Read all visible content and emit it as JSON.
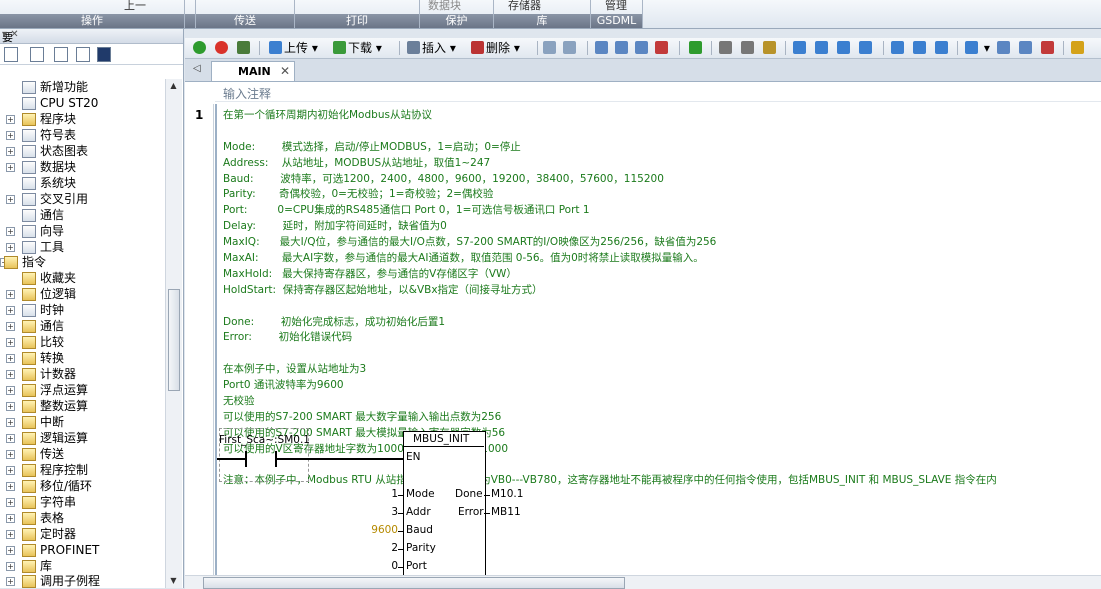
{
  "ribbon": {
    "top_fragments": [
      "上一",
      "数据块",
      "存储器",
      "管理"
    ],
    "groups": [
      "操作",
      "",
      "传送",
      "打印",
      "保护",
      "库",
      "GSDML"
    ]
  },
  "left_panel": {
    "title": "要",
    "tree": [
      {
        "label": "新增功能",
        "icon": "help-icon"
      },
      {
        "label": "CPU ST20",
        "icon": "cpu-icon"
      },
      {
        "label": "程序块",
        "icon": "folder-icon"
      },
      {
        "label": "符号表",
        "icon": "table-icon"
      },
      {
        "label": "状态图表",
        "icon": "table-icon"
      },
      {
        "label": "数据块",
        "icon": "table-icon"
      },
      {
        "label": "系统块",
        "icon": "system-icon"
      },
      {
        "label": "交叉引用",
        "icon": "table-icon"
      },
      {
        "label": "通信",
        "icon": "network-icon"
      },
      {
        "label": "向导",
        "icon": "wizard-icon"
      },
      {
        "label": "工具",
        "icon": "tools-icon"
      },
      {
        "label": "指令",
        "icon": "folder-icon"
      },
      {
        "label": "收藏夹",
        "icon": "folder-icon"
      },
      {
        "label": "位逻辑",
        "icon": "folder-icon"
      },
      {
        "label": "时钟",
        "icon": "clock-icon"
      },
      {
        "label": "通信",
        "icon": "folder-icon"
      },
      {
        "label": "比较",
        "icon": "folder-icon"
      },
      {
        "label": "转换",
        "icon": "folder-icon"
      },
      {
        "label": "计数器",
        "icon": "folder-icon"
      },
      {
        "label": "浮点运算",
        "icon": "folder-icon"
      },
      {
        "label": "整数运算",
        "icon": "folder-icon"
      },
      {
        "label": "中断",
        "icon": "folder-icon"
      },
      {
        "label": "逻辑运算",
        "icon": "folder-icon"
      },
      {
        "label": "传送",
        "icon": "folder-icon"
      },
      {
        "label": "程序控制",
        "icon": "folder-icon"
      },
      {
        "label": "移位/循环",
        "icon": "folder-icon"
      },
      {
        "label": "字符串",
        "icon": "folder-icon"
      },
      {
        "label": "表格",
        "icon": "folder-icon"
      },
      {
        "label": "定时器",
        "icon": "folder-icon"
      },
      {
        "label": "PROFINET",
        "icon": "folder-icon"
      },
      {
        "label": "库",
        "icon": "folder-icon"
      },
      {
        "label": "调用子例程",
        "icon": "folder-icon"
      }
    ]
  },
  "toolbar": {
    "upload": "上传",
    "download": "下载",
    "insert": "插入",
    "delete": "删除"
  },
  "tabs": {
    "main": "MAIN"
  },
  "editor": {
    "comment_placeholder": "输入注释",
    "network_number": "1",
    "comment_lines": [
      "在第一个循环周期内初始化Modbus从站协议",
      "",
      "Mode:        模式选择，启动/停止MODBUS，1=启动；0=停止",
      "Address:    从站地址，MODBUS从站地址，取值1~247",
      "Baud:        波特率，可选1200，2400，4800，9600，19200，38400，57600，115200",
      "Parity:       奇偶校验，0=无校验；1=奇校验；2=偶校验",
      "Port:         0=CPU集成的RS485通信口 Port 0，1=可选信号板通讯口 Port 1",
      "Delay:        延时，附加字符间延时，缺省值为0",
      "MaxIQ:      最大I/Q位，参与通信的最大I/O点数，S7-200 SMART的I/O映像区为256/256，缺省值为256",
      "MaxAI:       最大AI字数，参与通信的最大AI通道数，取值范围 0-56。值为0时将禁止读取模拟量输入。",
      "MaxHold:   最大保持寄存器区，参与通信的V存储区字（VW）",
      "HoldStart:  保持寄存器区起始地址，以&VBx指定（间接寻址方式）",
      "",
      "Done:        初始化完成标志，成功初始化后置1",
      "Error:        初始化错误代码",
      "",
      "在本例子中，设置从站地址为3",
      "Port0 通讯波特率为9600",
      "无校验",
      "可以使用的S7-200 SMART 最大数字量输入输出点数为256",
      "可以使用的S7-200 SMART 最大模拟量输入寄存器字数为56",
      "可以使用的V区寄存器地址字数为1000，起始地址为VB1000",
      "",
      "注意：本例子中，Modbus RTU 从站指令使用的库存储为VB0---VB780，这寄存器地址不能再被程序中的任何指令使用，包括MBUS_INIT 和 MBUS_SLAVE 指令在内"
    ],
    "contact_symbol": "First_Sca~:SM0.1",
    "block_name": "MBUS_INIT",
    "en": "EN",
    "inputs": [
      {
        "pin": "Mode",
        "value": "1"
      },
      {
        "pin": "Addr",
        "value": "3"
      },
      {
        "pin": "Baud",
        "value": "9600"
      },
      {
        "pin": "Parity",
        "value": "2"
      },
      {
        "pin": "Port",
        "value": "0"
      }
    ],
    "outputs": [
      {
        "pin": "Done",
        "value": "M10.1"
      },
      {
        "pin": "Error",
        "value": "MB11"
      }
    ]
  }
}
